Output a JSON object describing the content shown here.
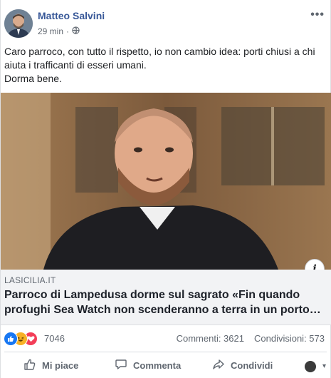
{
  "post": {
    "author": "Matteo Salvini",
    "time": "29 min",
    "separator": "·",
    "more_label": "•••",
    "text_lines": [
      "Caro parroco, con tutto il rispetto, io non cambio idea: porti chiusi a chi",
      "aiuta i trafficanti di esseri umani.",
      "Dorma bene."
    ]
  },
  "link_preview": {
    "domain": "LASICILIA.IT",
    "headline_lines": [
      "Parroco di Lampedusa dorme sul sagrato «Fin quando",
      "profughi Sea Watch non scenderanno a terra in un porto…"
    ],
    "info_label": "i"
  },
  "stats": {
    "reactions_count": "7046",
    "comments": "Commenti: 3621",
    "shares": "Condivisioni: 573"
  },
  "actions": {
    "like": "Mi piace",
    "comment": "Commenta",
    "share": "Condividi",
    "caret": "▾"
  },
  "colors": {
    "author": "#385898",
    "like_blue": "#1877f2",
    "love_red": "#f33e58",
    "haha_yellow": "#f7b125"
  },
  "icons": [
    "globe-icon",
    "like-reaction-icon",
    "haha-reaction-icon",
    "love-reaction-icon",
    "thumbs-up-icon",
    "comment-icon",
    "share-icon"
  ]
}
